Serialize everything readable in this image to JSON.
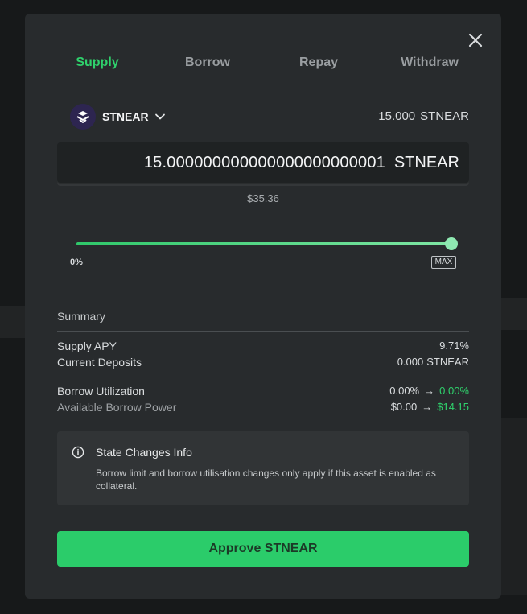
{
  "tabs": [
    {
      "label": "Supply",
      "active": true
    },
    {
      "label": "Borrow",
      "active": false
    },
    {
      "label": "Repay",
      "active": false
    },
    {
      "label": "Withdraw",
      "active": false
    }
  ],
  "token": {
    "name": "STNEAR",
    "icon": "stnear-logo-icon"
  },
  "balance": {
    "value": "15.000",
    "unit": "STNEAR"
  },
  "amount": {
    "value": "15.000000000000000000000001",
    "unit": "STNEAR",
    "usd": "$35.36"
  },
  "slider": {
    "min_label": "0%",
    "max_label": "MAX",
    "fraction": 1.0
  },
  "summary": {
    "title": "Summary",
    "supply_apy": {
      "label": "Supply APY",
      "value": "9.71%"
    },
    "current_deposits": {
      "label": "Current Deposits",
      "value": "0.000",
      "unit": "STNEAR"
    },
    "borrow_utilization": {
      "label": "Borrow Utilization",
      "from": "0.00%",
      "to": "0.00%"
    },
    "borrow_power": {
      "label": "Available Borrow Power",
      "from": "$0.00",
      "to": "$14.15"
    }
  },
  "info": {
    "title": "State Changes Info",
    "text": "Borrow limit and borrow utilisation changes only apply if this asset is enabled as collateral."
  },
  "approve_button": {
    "label": "Approve STNEAR"
  },
  "colors": {
    "accent": "#2fd16c",
    "button": "#2bcc6a",
    "modal": "#282b2d"
  }
}
